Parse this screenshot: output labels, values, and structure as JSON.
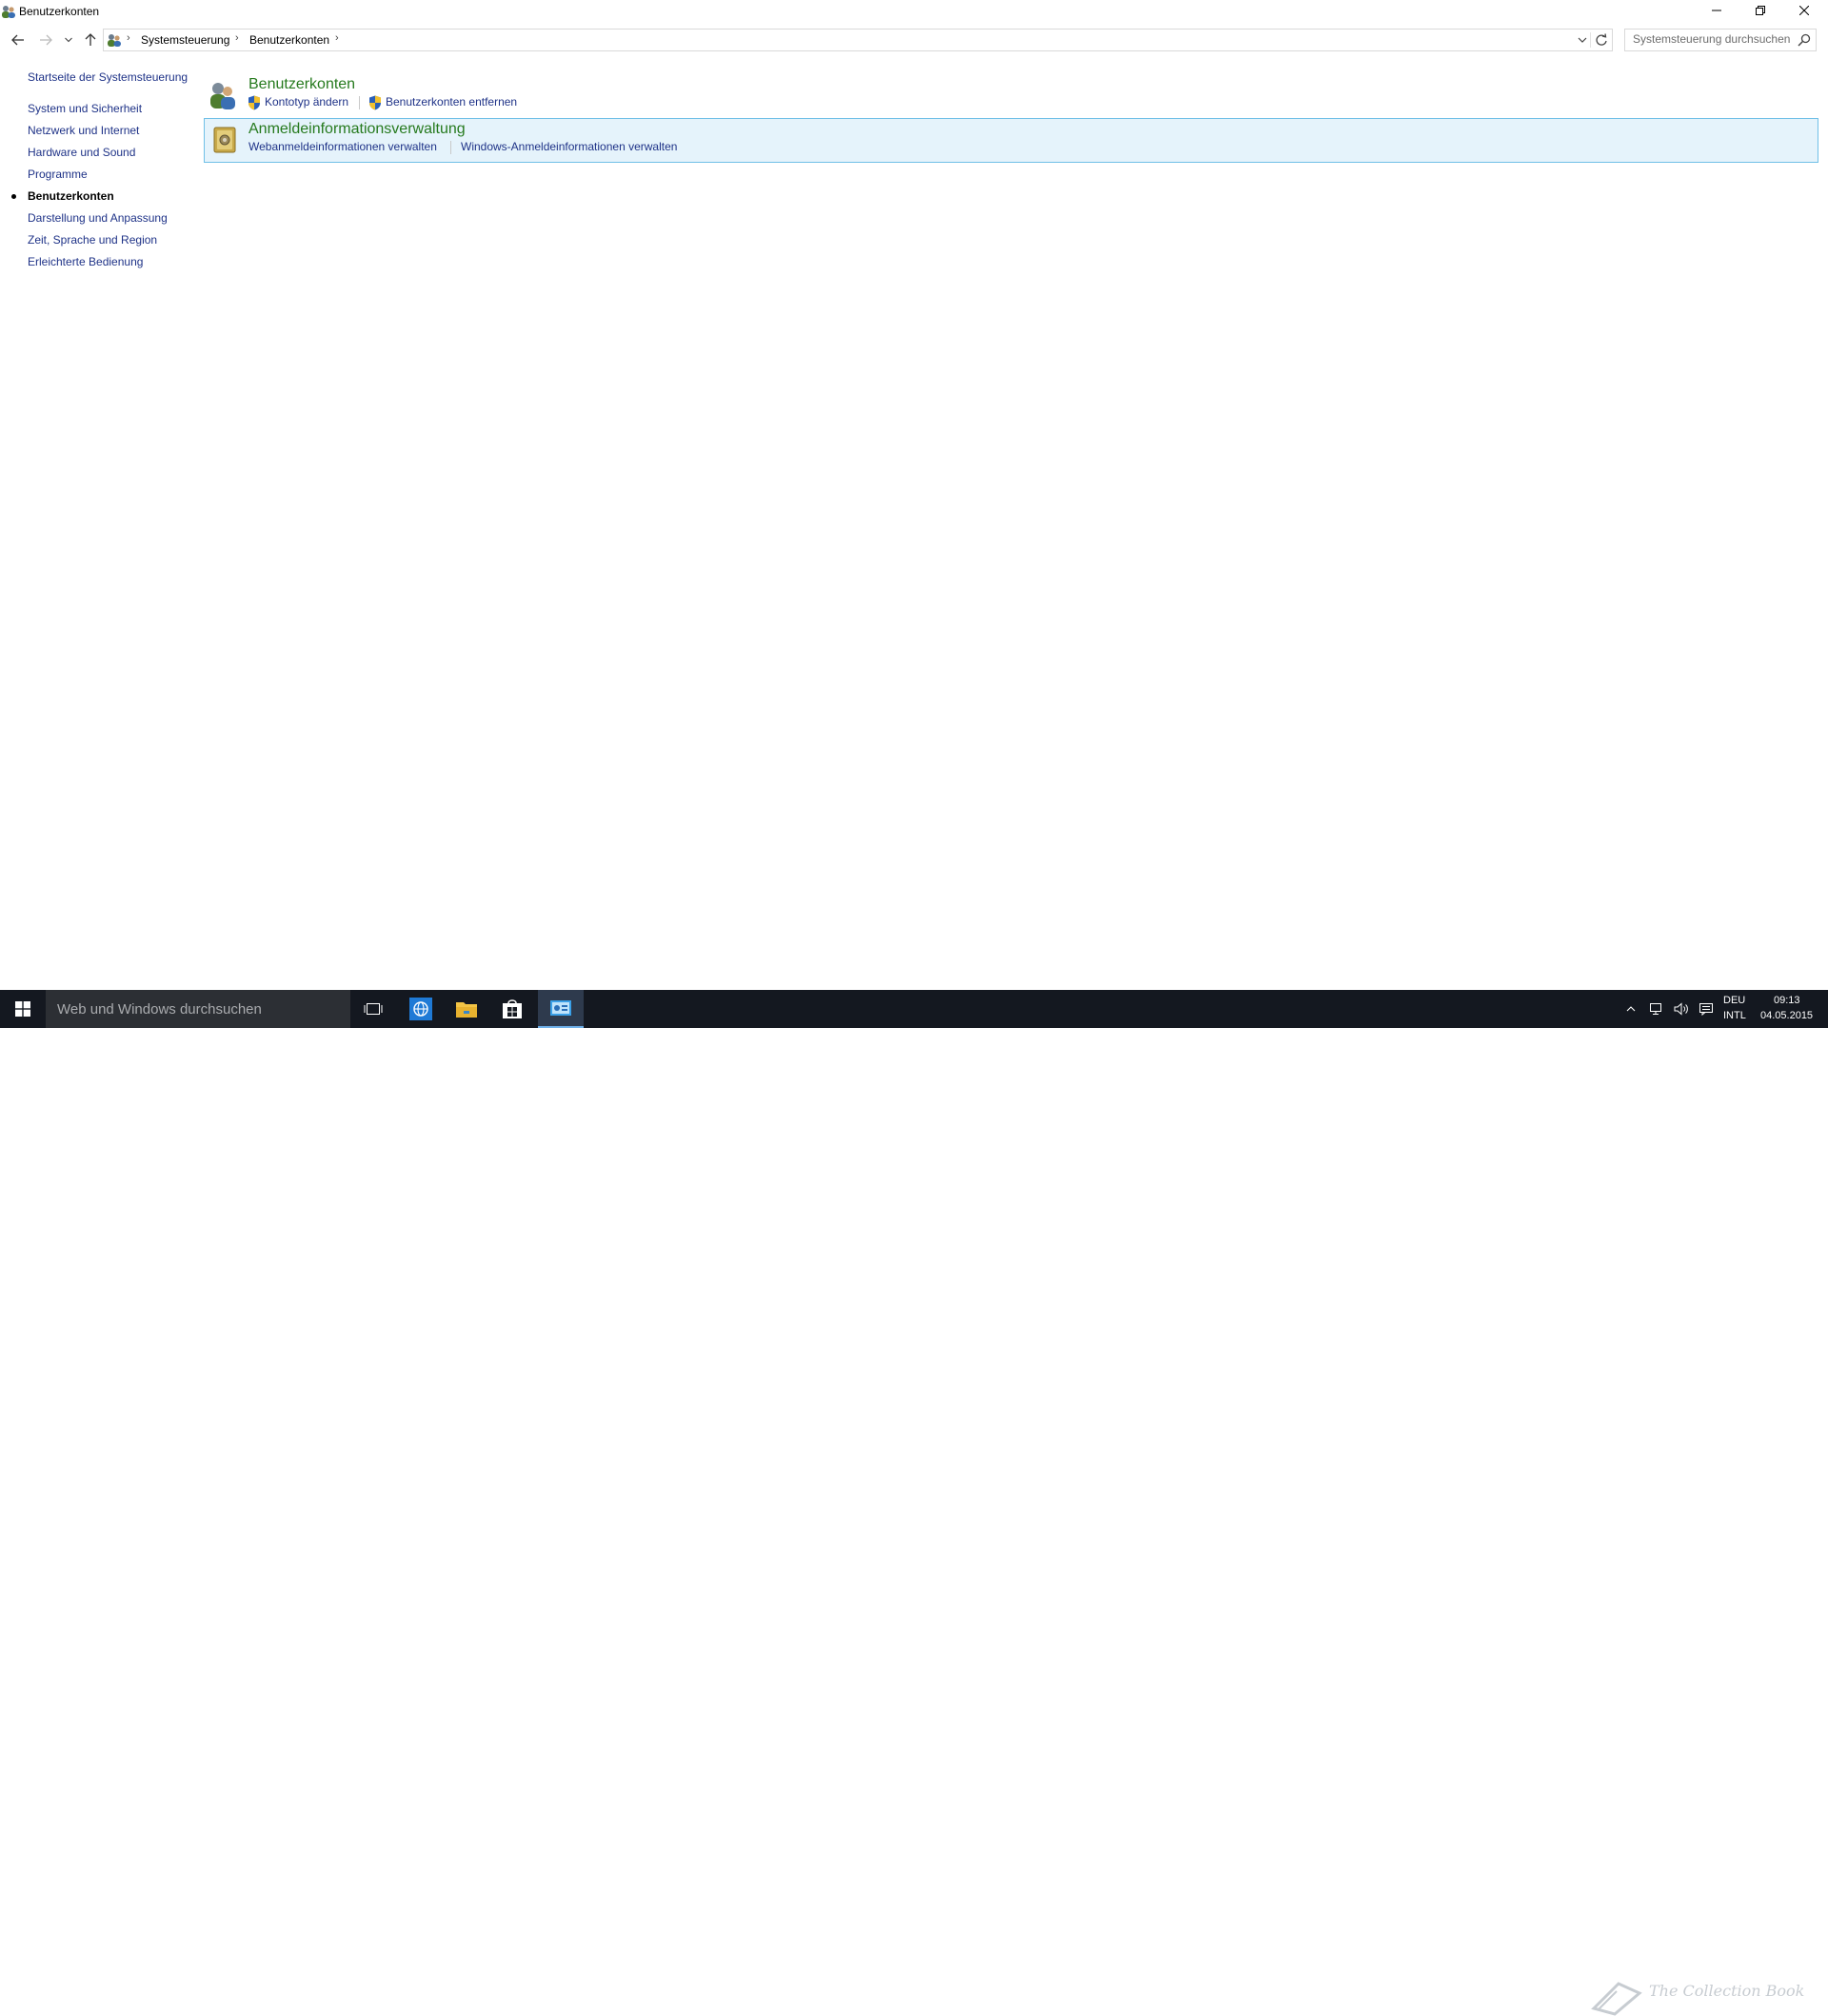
{
  "window": {
    "title": "Benutzerkonten",
    "icon": "user-accounts-icon",
    "controls": [
      "minimize-icon",
      "restore-icon",
      "close-icon"
    ]
  },
  "address_bar": {
    "icons": [
      "back-arrow-icon",
      "forward-arrow-icon",
      "recent-dropdown-icon",
      "up-arrow-icon"
    ],
    "breadcrumbs": [
      "Systemsteuerung",
      "Benutzerkonten"
    ],
    "refresh_icon": "refresh-icon"
  },
  "search": {
    "placeholder": "Systemsteuerung durchsuchen",
    "icon": "search-icon"
  },
  "left_pane": {
    "home_link": "Startseite der Systemsteuerung",
    "items": [
      {
        "label": "System und Sicherheit",
        "active": false
      },
      {
        "label": "Netzwerk und Internet",
        "active": false
      },
      {
        "label": "Hardware und Sound",
        "active": false
      },
      {
        "label": "Programme",
        "active": false
      },
      {
        "label": "Benutzerkonten",
        "active": true
      },
      {
        "label": "Darstellung und Anpassung",
        "active": false
      },
      {
        "label": "Zeit, Sprache und Region",
        "active": false
      },
      {
        "label": "Erleichterte Bedienung",
        "active": false
      }
    ]
  },
  "categories": [
    {
      "title": "Benutzerkonten",
      "icon": "user-accounts-icon",
      "tasks": [
        {
          "label": "Kontotyp ändern",
          "shield": true
        },
        {
          "label": "Benutzerkonten entfernen",
          "shield": true
        }
      ]
    },
    {
      "title": "Anmeldeinformationsverwaltung",
      "icon": "credential-vault-icon",
      "highlighted": true,
      "tasks": [
        {
          "label": "Webanmeldeinformationen verwalten",
          "shield": false
        },
        {
          "label": "Windows-Anmeldeinformationen verwalten",
          "shield": false
        }
      ]
    }
  ],
  "taskbar": {
    "search_placeholder": "Web und Windows durchsuchen",
    "apps": [
      "task-view-icon",
      "browser-icon",
      "file-explorer-icon",
      "store-icon",
      "control-panel-icon"
    ],
    "tray": {
      "language_top": "DEU",
      "language_bottom": "INTL",
      "time": "09:13",
      "date": "04.05.2015"
    }
  },
  "watermark": "The Collection Book",
  "colors": {
    "link": "#1e3287",
    "category_title": "#267a1e",
    "highlight_bg": "#e5f3fb",
    "highlight_border": "#70c0e7",
    "taskbar": "#141820"
  }
}
